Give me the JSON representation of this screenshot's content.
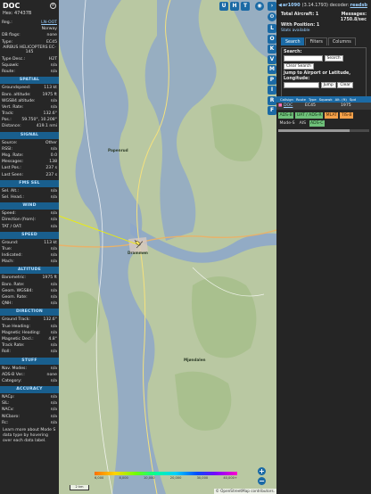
{
  "left_panel": {
    "callsign": "DOC",
    "hex_label": "Hex:",
    "hex": "47437B",
    "rows_top": [
      {
        "k": "Reg.:",
        "v": "LN-OOT",
        "link": true
      },
      {
        "k": "",
        "v": "Norway"
      },
      {
        "k": "DB flags:",
        "v": "none"
      },
      {
        "k": "Type:",
        "v": "EC45"
      },
      {
        "k": "",
        "v": "AIRBUS HELICOPTERS EC-145",
        "center": true
      },
      {
        "k": "Type Desc.:",
        "v": "H2T"
      },
      {
        "k": "Squawk:",
        "v": "n/a"
      },
      {
        "k": "Route:",
        "v": "n/a"
      }
    ],
    "sections": [
      {
        "title": "SPATIAL",
        "rows": [
          {
            "k": "Groundspeed:",
            "v": "113 kt"
          },
          {
            "k": "Baro. altitude:",
            "v": "1975 ft"
          },
          {
            "k": "WGS84 altitude:",
            "v": "n/a"
          },
          {
            "k": "Vert. Rate:",
            "v": "n/a"
          },
          {
            "k": "Track:",
            "v": "132.6°"
          },
          {
            "k": "Pos.:",
            "v": "59.750°, 10.208°"
          },
          {
            "k": "Distance:",
            "v": "419.1 nmi"
          }
        ]
      },
      {
        "title": "SIGNAL",
        "rows": [
          {
            "k": "Source:",
            "v": "Other"
          },
          {
            "k": "RSSI:",
            "v": "n/a"
          },
          {
            "k": "Msg. Rate:",
            "v": "0.0"
          },
          {
            "k": "Messages:",
            "v": "138"
          },
          {
            "k": "Last Pos.:",
            "v": "237 s"
          },
          {
            "k": "Last Seen:",
            "v": "237 s"
          }
        ]
      },
      {
        "title": "FMS SEL",
        "rows": [
          {
            "k": "Sel. Alt.:",
            "v": "n/a"
          },
          {
            "k": "Sel. Head.:",
            "v": "n/a"
          }
        ]
      },
      {
        "title": "WIND",
        "rows": [
          {
            "k": "Speed:",
            "v": "n/a"
          },
          {
            "k": "Direction (from):",
            "v": "n/a"
          },
          {
            "k": "TAT / OAT:",
            "v": "n/a"
          }
        ]
      },
      {
        "title": "SPEED",
        "rows": [
          {
            "k": "Ground:",
            "v": "113 kt"
          },
          {
            "k": "True:",
            "v": "n/a"
          },
          {
            "k": "Indicated:",
            "v": "n/a"
          },
          {
            "k": "Mach:",
            "v": "n/a"
          }
        ]
      },
      {
        "title": "ALTITUDE",
        "rows": [
          {
            "k": "Barometric:",
            "v": "1975 ft"
          },
          {
            "k": "Baro. Rate:",
            "v": "n/a"
          },
          {
            "k": "Geom. WGS84:",
            "v": "n/a"
          },
          {
            "k": "Geom. Rate:",
            "v": "n/a"
          },
          {
            "k": "QNH:",
            "v": "n/a"
          }
        ]
      },
      {
        "title": "DIRECTION",
        "rows": [
          {
            "k": "Ground Track:",
            "v": "132.6°"
          },
          {
            "k": "True Heading:",
            "v": "n/a"
          },
          {
            "k": "Magnetic Heading:",
            "v": "n/a"
          },
          {
            "k": "Magnetic Decl.:",
            "v": "4.8°"
          },
          {
            "k": "Track Rate:",
            "v": "n/a"
          },
          {
            "k": "Roll:",
            "v": "n/a"
          }
        ]
      },
      {
        "title": "STUFF",
        "rows": [
          {
            "k": "Nav. Modes:",
            "v": "n/a"
          },
          {
            "k": "ADS-B Ver.:",
            "v": "none"
          },
          {
            "k": "Category:",
            "v": "n/a"
          }
        ]
      },
      {
        "title": "ACCURACY",
        "rows": [
          {
            "k": "NACp:",
            "v": "n/a"
          },
          {
            "k": "SIL:",
            "v": "n/a"
          },
          {
            "k": "NACv:",
            "v": "n/a"
          },
          {
            "k": "NICbaro:",
            "v": "n/a"
          },
          {
            "k": "Rc:",
            "v": "n/a"
          }
        ]
      }
    ],
    "note": "Learn more about Mode S data type by hovering over each data label."
  },
  "map": {
    "top_buttons": [
      "U",
      "H",
      "T"
    ],
    "side_buttons": [
      "L",
      "O",
      "K",
      "V",
      "M",
      "P",
      "I",
      "R",
      "F"
    ],
    "zoom_in": "+",
    "zoom_out": "−",
    "legend_labels": [
      "6,000",
      "8,000",
      "10,000",
      "20,000",
      "30,000",
      "40,000+"
    ],
    "scale_text": "2 km",
    "attribution": "© OpenStreetMap contributors.",
    "place_labels": [
      "Drammen",
      "Papenrud",
      "Mjøndalen"
    ]
  },
  "right_panel": {
    "version": "ar1090",
    "version_detail": "(3.14.1793) decoder:",
    "decoder_link": "readsb",
    "total_aircraft_label": "Total Aircraft:",
    "total_aircraft": "1",
    "messages_label": "Messages:",
    "messages": "1750.8/sec",
    "with_position_label": "With Position:",
    "with_position": "1",
    "stats_link": "Stats available",
    "tabs": [
      "Search",
      "Filters",
      "Columns"
    ],
    "search_label": "Search:",
    "search_button": "Search",
    "clear_search_button": "Clear Search",
    "jump_label": "Jump to Airport or Latitude, Longitude:",
    "jump_button": "Jump",
    "clear_button": "Clear",
    "table_headers": [
      "Callsign",
      "Route",
      "Type",
      "Squawk",
      "Alt. (ft)",
      "Spd"
    ],
    "table_row": {
      "callsign": "DOC",
      "type": "EC45",
      "alt": "1975"
    },
    "badges": [
      {
        "text": "ADS-B",
        "color": "green"
      },
      {
        "text": "UAT / ADS-R",
        "color": "green"
      },
      {
        "text": "MLAT",
        "color": "orange"
      },
      {
        "text": "TIS-B",
        "color": "orange"
      },
      {
        "text": "Mode-S",
        "color": "plain"
      },
      {
        "text": "AIS",
        "color": "plain"
      },
      {
        "text": "ADS-C",
        "color": "green"
      }
    ]
  },
  "colors": {
    "accent": "#1b6aa5",
    "section_bg": "#195f8e",
    "link": "#9cd0ff",
    "badge_green": "#6fc17a",
    "badge_orange": "#f4a14a"
  }
}
